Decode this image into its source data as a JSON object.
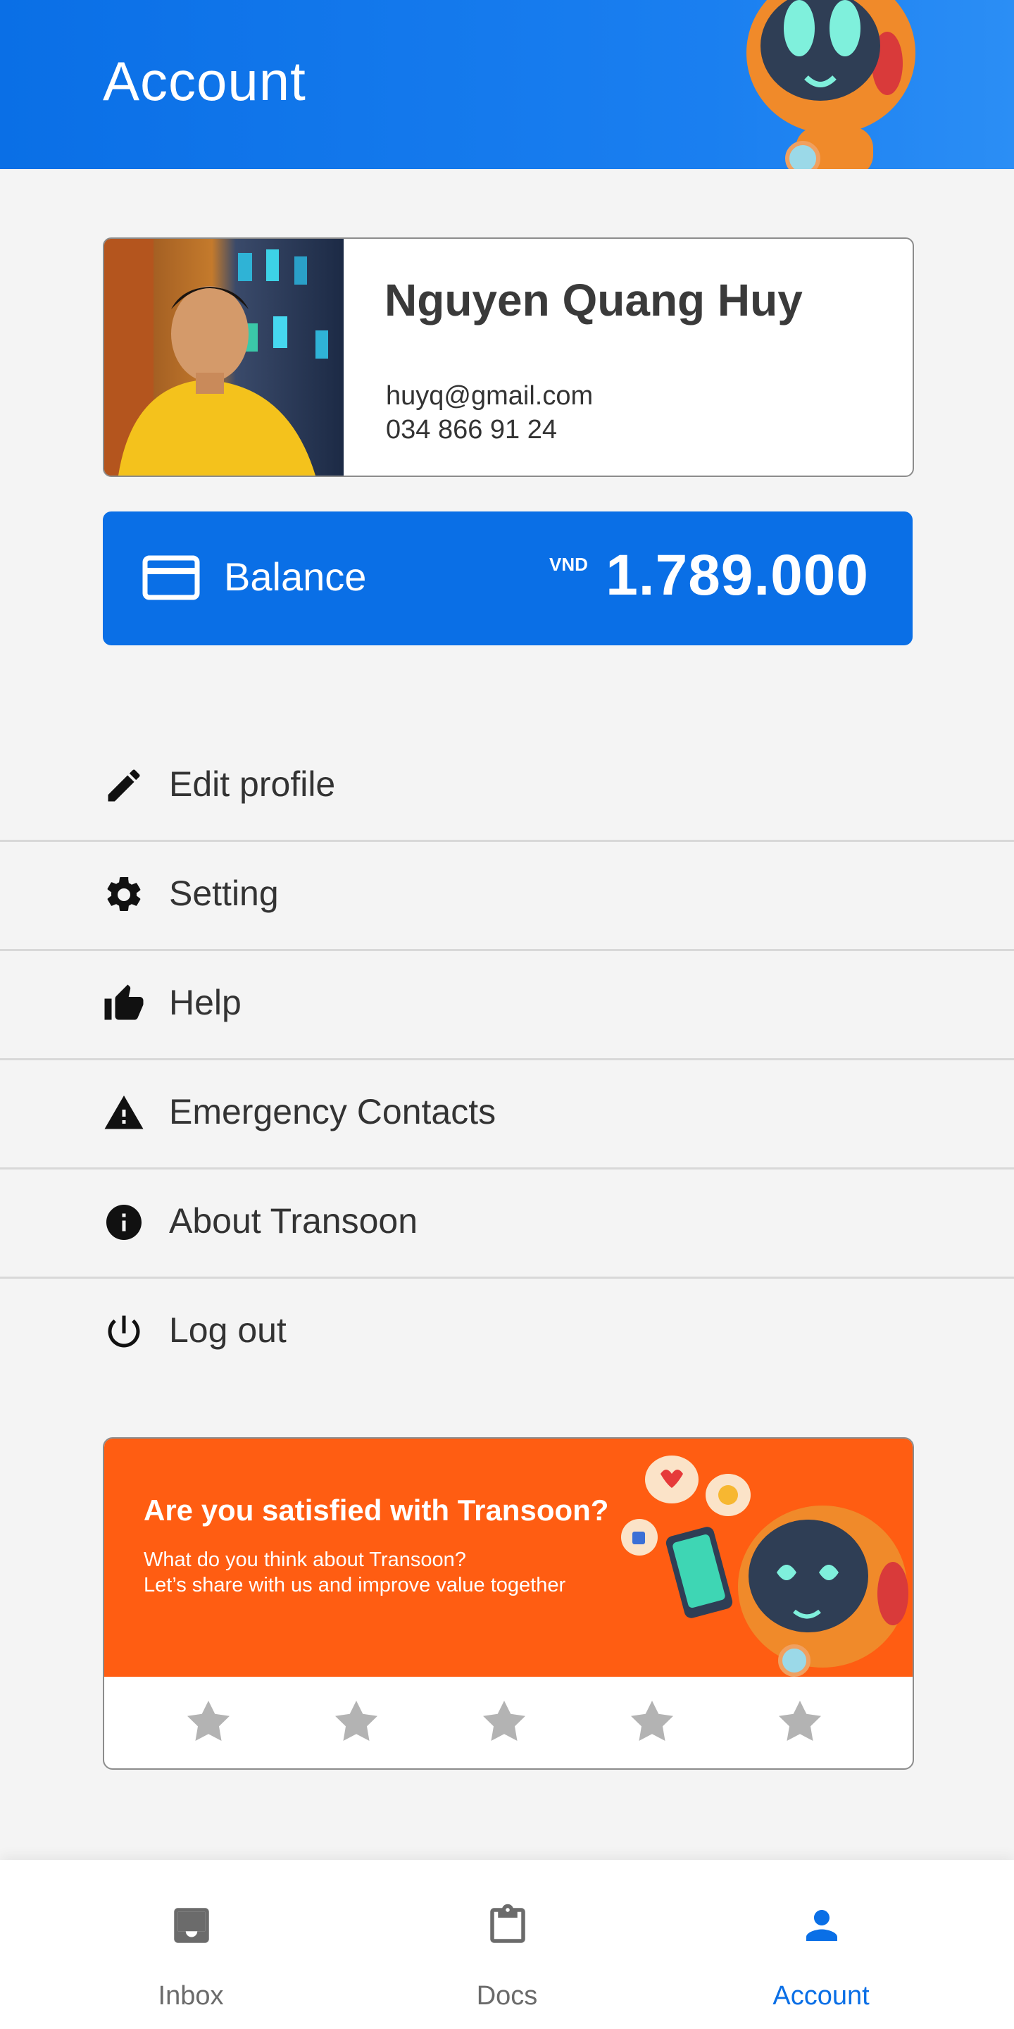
{
  "header": {
    "title": "Account"
  },
  "profile": {
    "name": "Nguyen Quang Huy",
    "email": "huyq@gmail.com",
    "phone": "034 866 91 24"
  },
  "balance": {
    "label": "Balance",
    "currency": "VND",
    "amount": "1.789.000",
    "icon": "credit-card-icon"
  },
  "menu": {
    "items": [
      {
        "label": "Edit profile",
        "icon": "pencil-icon"
      },
      {
        "label": "Setting",
        "icon": "gear-icon"
      },
      {
        "label": "Help",
        "icon": "thumbs-up-icon"
      },
      {
        "label": "Emergency Contacts",
        "icon": "warning-icon"
      },
      {
        "label": "About Transoon",
        "icon": "info-icon"
      },
      {
        "label": "Log out",
        "icon": "power-icon"
      }
    ]
  },
  "survey": {
    "title": "Are you satisfied with Transoon?",
    "line1": "What do you think about Transoon?",
    "line2": "Let’s share with us and improve value together",
    "rating": 0,
    "max_rating": 5
  },
  "nav": {
    "items": [
      {
        "label": "Inbox",
        "icon": "inbox-icon",
        "active": false
      },
      {
        "label": "Docs",
        "icon": "clipboard-icon",
        "active": false
      },
      {
        "label": "Account",
        "icon": "person-icon",
        "active": true
      }
    ]
  },
  "colors": {
    "primary": "#0a6fe6",
    "survey_bg": "#ff5d12",
    "star_empty": "#b3b3b3",
    "background": "#f4f4f4"
  }
}
